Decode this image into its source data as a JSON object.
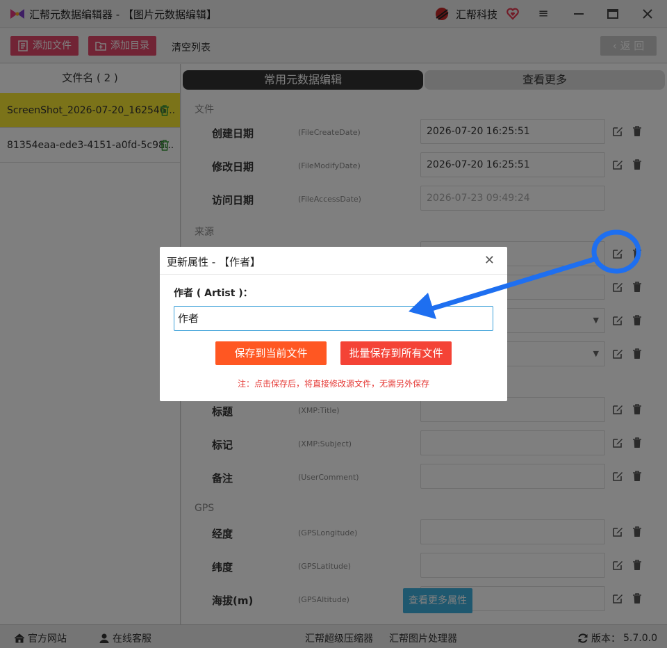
{
  "window": {
    "title": "汇帮元数据编辑器 - 【图片元数据编辑】",
    "brand": "汇帮科技"
  },
  "toolbar": {
    "add_file": "添加文件",
    "add_dir": "添加目录",
    "clear_list": "清空列表",
    "back": "返 回"
  },
  "sidebar": {
    "header": "文件名 ( 2 )",
    "files": [
      {
        "name": "ScreenShot_2026-07-20_162546..."
      },
      {
        "name": "81354eaa-ede3-4151-a0fd-5c98..."
      }
    ]
  },
  "tabs": {
    "common": "常用元数据编辑",
    "more": "查看更多"
  },
  "sections": {
    "file": "文件",
    "source": "来源",
    "gps": "GPS"
  },
  "rows": {
    "create": {
      "label": "创建日期",
      "tag": "(FileCreateDate)",
      "value": "2026-07-20 16:25:51"
    },
    "modify": {
      "label": "修改日期",
      "tag": "(FileModifyDate)",
      "value": "2026-07-20 16:25:51"
    },
    "access": {
      "label": "访问日期",
      "tag": "(FileAccessDate)",
      "value": "2026-07-23 09:49:24"
    },
    "title": {
      "label": "标题",
      "tag": "(XMP:Title)",
      "value": ""
    },
    "subject": {
      "label": "标记",
      "tag": "(XMP:Subject)",
      "value": ""
    },
    "comment": {
      "label": "备注",
      "tag": "(UserComment)",
      "value": ""
    },
    "longitude": {
      "label": "经度",
      "tag": "(GPSLongitude)",
      "value": ""
    },
    "latitude": {
      "label": "纬度",
      "tag": "(GPSLatitude)",
      "value": ""
    },
    "altitude": {
      "label": "海拔(m)",
      "tag": "(GPSAltitude)",
      "value": ""
    }
  },
  "see_more_button": "查看更多属性",
  "statusbar": {
    "website": "官方网站",
    "support": "在线客服",
    "compressor": "汇帮超级压缩器",
    "image_tool": "汇帮图片处理器",
    "version_label": "版本：",
    "version": "5.7.0.0"
  },
  "dialog": {
    "title": "更新属性 - 【作者】",
    "field_label": "作者 ( Artist )：",
    "field_value": "作者",
    "save_current": "保存到当前文件",
    "save_all": "批量保存到所有文件",
    "note": "注：点击保存后，将直接修改源文件，无需另外保存"
  },
  "colors": {
    "add_button": "#e2486b",
    "selected_file": "#f7e633",
    "annotation": "#1e6ff0",
    "save_button": "#ff5722",
    "batch_button": "#f44336",
    "note": "#e53935"
  },
  "icons": [
    "app-logo-icon",
    "brand-logo-icon",
    "heart-icon",
    "menu-icon",
    "minimize-icon",
    "maximize-icon",
    "close-icon",
    "add-file-icon",
    "add-folder-icon",
    "back-chevron-icon",
    "trash-icon",
    "edit-icon",
    "home-icon",
    "user-icon",
    "refresh-icon"
  ]
}
